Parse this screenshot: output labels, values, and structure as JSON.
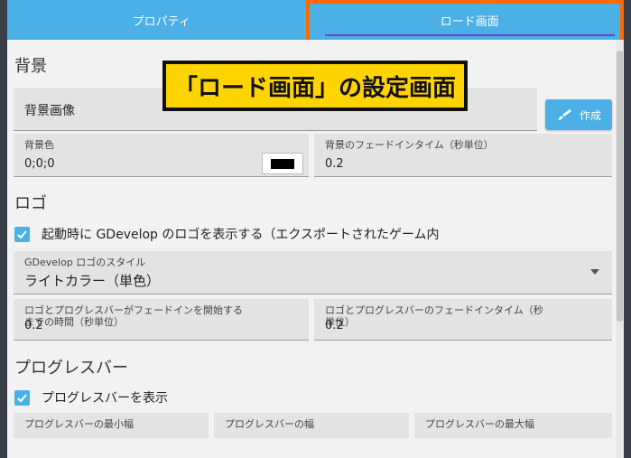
{
  "tabs": [
    {
      "label": "プロパティ"
    },
    {
      "label": "ロード画面"
    }
  ],
  "banner": "「ロード画面」の設定画面",
  "background_section": {
    "title": "背景",
    "image_label": "背景画像",
    "make_button": "作成",
    "color_label": "背景色",
    "color_value": "0;0;0",
    "color_swatch": "#000000",
    "fade_label": "背景のフェードインタイム（秒単位）",
    "fade_value": "0.2"
  },
  "logo_section": {
    "title": "ロゴ",
    "show_logo_label": "起動時に GDevelop のロゴを表示する（エクスポートされたゲーム内",
    "style_label": "GDevelop ロゴのスタイル",
    "style_value": "ライトカラー（単色）",
    "delay_label": "ロゴとプログレスバーがフェードインを開始するまでの時間（秒単位）",
    "delay_value": "0.2",
    "fade_label": "ロゴとプログレスバーのフェードインタイム（秒単位）",
    "fade_value": "0.2"
  },
  "progress_section": {
    "title": "プログレスバー",
    "show_label": "プログレスバーを表示",
    "min_width_label": "プログレスバーの最小幅",
    "width_label": "プログレスバーの幅",
    "max_width_label": "プログレスバーの最大幅"
  },
  "colors": {
    "accent": "#4ab0e6",
    "highlight": "#ff6a00",
    "banner": "#ffd400"
  }
}
